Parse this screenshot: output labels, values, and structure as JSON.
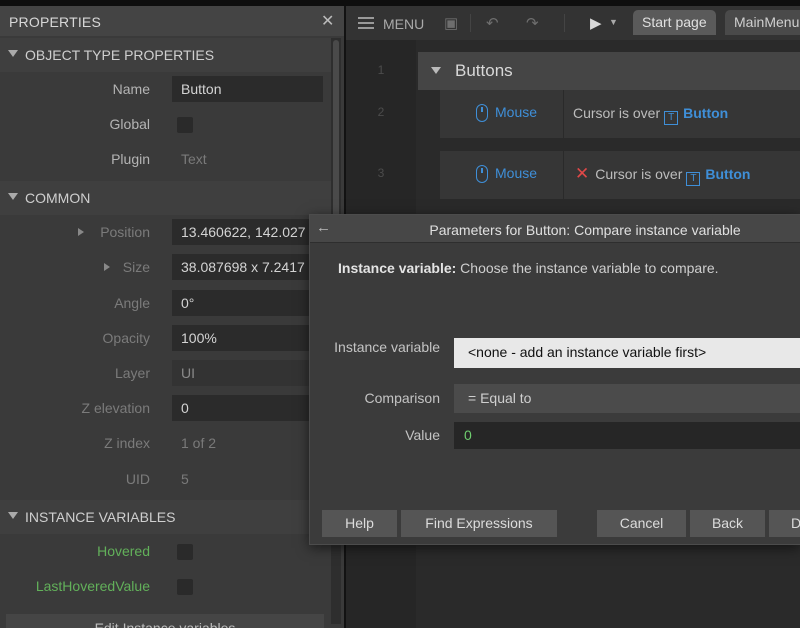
{
  "properties_panel": {
    "title": "PROPERTIES",
    "close_glyph": "✕",
    "sections": {
      "object_type": "OBJECT TYPE PROPERTIES",
      "common": "COMMON",
      "instance_variables": "INSTANCE VARIABLES"
    },
    "object_type_rows": {
      "name_label": "Name",
      "name_value": "Button",
      "global_label": "Global",
      "plugin_label": "Plugin",
      "plugin_value": "Text"
    },
    "common_rows": {
      "position_label": "Position",
      "position_value": "13.460622, 142.027",
      "size_label": "Size",
      "size_value": "38.087698 x 7.2417",
      "angle_label": "Angle",
      "angle_value": "0°",
      "opacity_label": "Opacity",
      "opacity_value": "100%",
      "layer_label": "Layer",
      "layer_value": "UI",
      "z_elevation_label": "Z elevation",
      "z_elevation_value": "0",
      "z_index_label": "Z index",
      "z_index_value": "1 of 2",
      "uid_label": "UID",
      "uid_value": "5"
    },
    "instance_variables": {
      "hovered_label": "Hovered",
      "last_hovered_label": "LastHoveredValue",
      "edit_button": "Edit Instance variables"
    }
  },
  "toolbar": {
    "menu_label": "MENU",
    "tabs": [
      "Start page",
      "MainMenu"
    ]
  },
  "event_sheet": {
    "line_numbers": [
      "1",
      "2",
      "3"
    ],
    "group_title": "Buttons",
    "events": [
      {
        "object": "Mouse",
        "condition": "Cursor is over",
        "target": "Button",
        "inverted": false
      },
      {
        "object": "Mouse",
        "condition": "Cursor is over",
        "target": "Button",
        "inverted": true
      }
    ]
  },
  "dialog": {
    "back_glyph": "←",
    "title": "Parameters for Button: Compare instance variable",
    "description_bold": "Instance variable:",
    "description_text": " Choose the instance variable to compare.",
    "fields": {
      "instance_variable_label": "Instance variable",
      "instance_variable_value": "<none - add an instance variable first>",
      "comparison_label": "Comparison",
      "comparison_value": "= Equal to",
      "value_label": "Value",
      "value_value": "0"
    },
    "buttons": {
      "help": "Help",
      "find_expressions": "Find Expressions",
      "cancel": "Cancel",
      "back": "Back",
      "done": "Done"
    }
  },
  "colors": {
    "accent_blue": "#3f8fd8",
    "invert_red": "#e04848",
    "instance_var_green": "#62b05a",
    "value_green": "#6fce6f"
  }
}
